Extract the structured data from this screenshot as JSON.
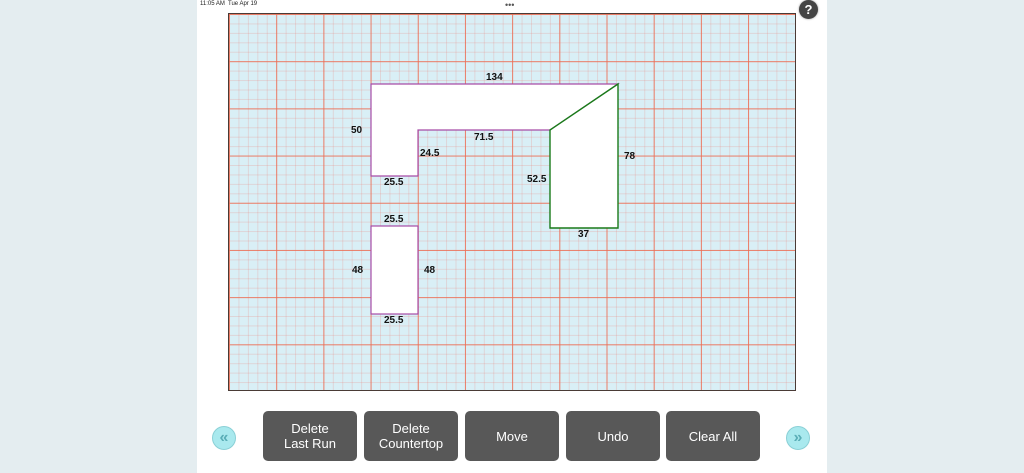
{
  "status_bar": {
    "time": "11:05 AM",
    "date": "Tue Apr 19",
    "menu_dots": "•••"
  },
  "help_button": {
    "label": "?"
  },
  "canvas": {
    "dimensions": {
      "l_top": "134",
      "l_left": "50",
      "l_inner": "71.5",
      "l_step": "24.5",
      "l_bottom": "25.5",
      "trap_right": "78",
      "trap_left": "52.5",
      "trap_bottom": "37",
      "rect_top": "25.5",
      "rect_left": "48",
      "rect_right": "48",
      "rect_bottom": "25.5"
    }
  },
  "toolbar": {
    "delete_last_run": "Delete\nLast Run",
    "delete_countertop": "Delete\nCountertop",
    "move": "Move",
    "undo": "Undo",
    "clear_all": "Clear All"
  },
  "nav": {
    "prev_icon": "chevron-double-left",
    "next_icon": "chevron-double-right"
  },
  "colors": {
    "grid_major": "#ec6e54",
    "canvas_bg": "#d9eff6",
    "l_shape_stroke": "#a64ca6",
    "trapezoid_stroke": "#1a7a1a",
    "button_bg": "#585858",
    "nav_bg": "#a9e9ee"
  }
}
